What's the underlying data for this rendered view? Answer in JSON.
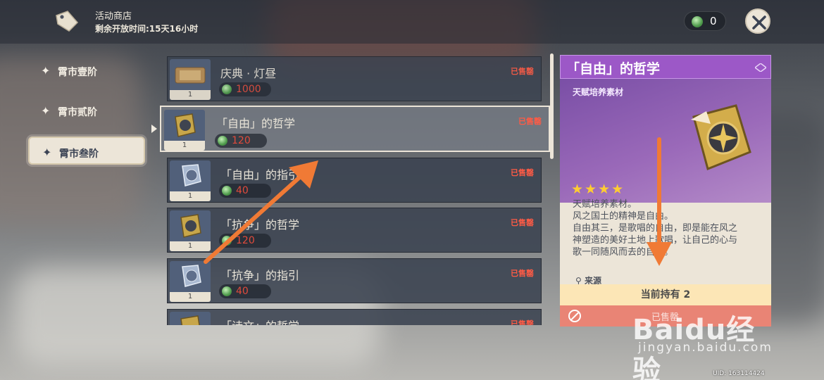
{
  "shop": {
    "title": "活动商店",
    "remaining": "剩余开放时间:15天16小时",
    "currency_count": "0"
  },
  "tabs": [
    {
      "label": "霄市壹阶"
    },
    {
      "label": "霄市贰阶"
    },
    {
      "label": "霄市叁阶"
    }
  ],
  "items": [
    {
      "name": "庆典 · 灯昼",
      "qty": "1",
      "price": "1000",
      "status": "已售罄"
    },
    {
      "name": "「自由」的哲学",
      "qty": "1",
      "price": "120",
      "status": "已售罄"
    },
    {
      "name": "「自由」的指引",
      "qty": "1",
      "price": "40",
      "status": "已售罄"
    },
    {
      "name": "「抗争」的哲学",
      "qty": "1",
      "price": "120",
      "status": "已售罄"
    },
    {
      "name": "「抗争」的指引",
      "qty": "1",
      "price": "40",
      "status": "已售罄"
    },
    {
      "name": "「诗文」的哲学",
      "qty": "",
      "price": "",
      "status": "已售罄"
    }
  ],
  "detail": {
    "title": "「自由」的哲学",
    "category": "天赋培养素材",
    "stars": "★★★★",
    "description": [
      "天赋培养素材。",
      "风之国土的精神是自由。",
      "自由其三，是歌唱的自由，即是能在风之",
      "神塑造的美好土地上歌唱，让自己的心与",
      "歌一同随风而去的自由。"
    ],
    "source_label": "来源",
    "owned": "当前持有 2",
    "buy_status": "已售罄"
  },
  "uid": "UID: 163114424",
  "watermark": {
    "brand": "Baidu经验",
    "url": "jingyan.baidu.com"
  },
  "colors": {
    "accent_purple": "#9c58c7",
    "sold_red": "#ff5b45",
    "panel": "#ece5d8",
    "star": "#ffcc32",
    "arrow": "#f07a35"
  }
}
